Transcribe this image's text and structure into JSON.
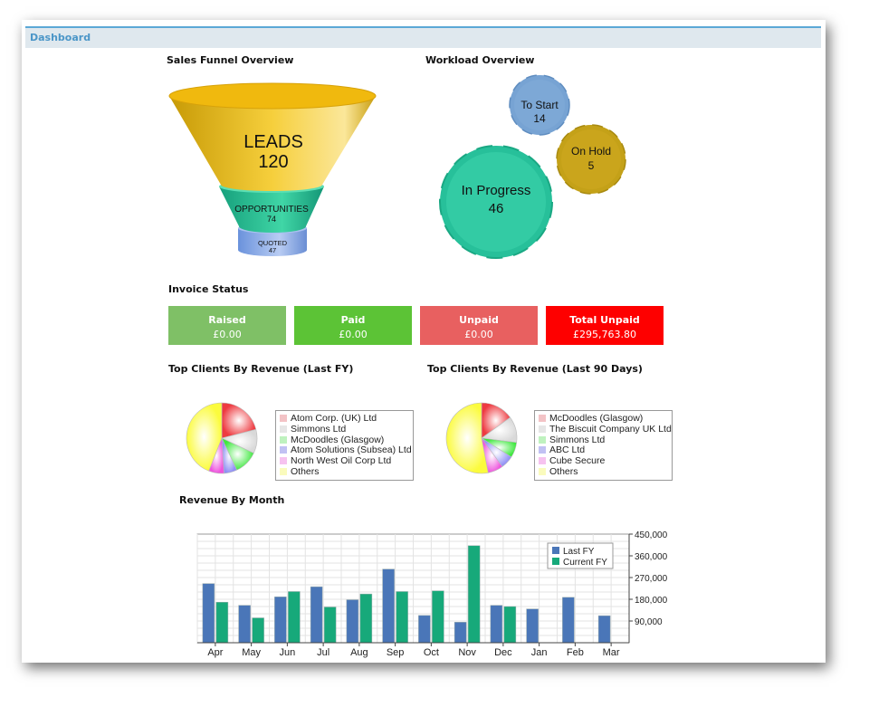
{
  "header": {
    "title": "Dashboard"
  },
  "sales_funnel": {
    "title": "Sales Funnel Overview",
    "leads_label": "LEADS",
    "leads_value": "120",
    "opportunities_label": "OPPORTUNITIES",
    "opportunities_value": "74",
    "quoted_label": "QUOTED",
    "quoted_value": "47"
  },
  "workload": {
    "title": "Workload Overview",
    "to_start_label": "To Start",
    "to_start_value": "14",
    "on_hold_label": "On Hold",
    "on_hold_value": "5",
    "in_progress_label": "In Progress",
    "in_progress_value": "46"
  },
  "invoice_status": {
    "title": "Invoice Status",
    "raised_label": "Raised",
    "raised_value": "£0.00",
    "paid_label": "Paid",
    "paid_value": "£0.00",
    "unpaid_label": "Unpaid",
    "unpaid_value": "£0.00",
    "total_unpaid_label": "Total Unpaid",
    "total_unpaid_value": "£295,763.80",
    "colors": {
      "raised": "#7fc066",
      "paid": "#5cc336",
      "unpaid": "#e86060",
      "total_unpaid": "#fe0000"
    }
  },
  "top_clients_fy": {
    "title": "Top Clients By Revenue (Last FY)",
    "legend": [
      {
        "label": "Atom Corp. (UK) Ltd",
        "color": "#f3c3c6"
      },
      {
        "label": "Simmons Ltd",
        "color": "#e6e6e6"
      },
      {
        "label": "McDoodles (Glasgow)",
        "color": "#bff2bf"
      },
      {
        "label": "Atom Solutions (Subsea) Ltd",
        "color": "#c1c1f3"
      },
      {
        "label": "North West Oil Corp Ltd",
        "color": "#f6c2ef"
      },
      {
        "label": "Others",
        "color": "#fafbbd"
      }
    ]
  },
  "top_clients_90": {
    "title": "Top Clients By Revenue (Last 90 Days)",
    "legend": [
      {
        "label": "McDoodles (Glasgow)",
        "color": "#f3c3c6"
      },
      {
        "label": "The Biscuit Company UK Ltd",
        "color": "#e6e6e6"
      },
      {
        "label": "Simmons Ltd",
        "color": "#bff2bf"
      },
      {
        "label": "ABC Ltd",
        "color": "#c1c1f3"
      },
      {
        "label": "Cube Secure",
        "color": "#f6c2ef"
      },
      {
        "label": "Others",
        "color": "#fafbbd"
      }
    ]
  },
  "chart_data": [
    {
      "type": "pie",
      "title": "Top Clients By Revenue (Last FY)",
      "labels": [
        "Atom Corp. (UK) Ltd",
        "Simmons Ltd",
        "McDoodles (Glasgow)",
        "Atom Solutions (Subsea) Ltd",
        "North West Oil Corp Ltd",
        "Others"
      ],
      "values": [
        21,
        11,
        11,
        6,
        7,
        44
      ],
      "colors": [
        "#ee3a40",
        "#d9d9d9",
        "#3ee83e",
        "#8f8ff5",
        "#ee55dd",
        "#fbfb3d"
      ]
    },
    {
      "type": "pie",
      "title": "Top Clients By Revenue (Last 90 Days)",
      "labels": [
        "McDoodles (Glasgow)",
        "The Biscuit Company UK Ltd",
        "Simmons Ltd",
        "ABC Ltd",
        "Cube Secure",
        "Others"
      ],
      "values": [
        15,
        12,
        7,
        6,
        7,
        53
      ],
      "colors": [
        "#ee3a40",
        "#d9d9d9",
        "#3ee83e",
        "#8f8ff5",
        "#ee55dd",
        "#fbfb3d"
      ]
    },
    {
      "type": "bar",
      "title": "Revenue By Month",
      "categories": [
        "Apr",
        "May",
        "Jun",
        "Jul",
        "Aug",
        "Sep",
        "Oct",
        "Nov",
        "Dec",
        "Jan",
        "Feb",
        "Mar"
      ],
      "series": [
        {
          "name": "Last FY",
          "color": "#4a76b8",
          "values": [
            245000,
            155000,
            190000,
            232000,
            178000,
            305000,
            113000,
            85000,
            155000,
            140000,
            188000,
            112000
          ]
        },
        {
          "name": "Current FY",
          "color": "#17a97a",
          "values": [
            168000,
            103000,
            212000,
            148000,
            202000,
            212000,
            215000,
            402000,
            150000,
            null,
            null,
            null
          ]
        }
      ],
      "yticks": [
        "90,000",
        "180,000",
        "270,000",
        "360,000",
        "450,000"
      ],
      "ylim": [
        0,
        450000
      ],
      "legend_position": "top-right",
      "grid": true
    }
  ]
}
